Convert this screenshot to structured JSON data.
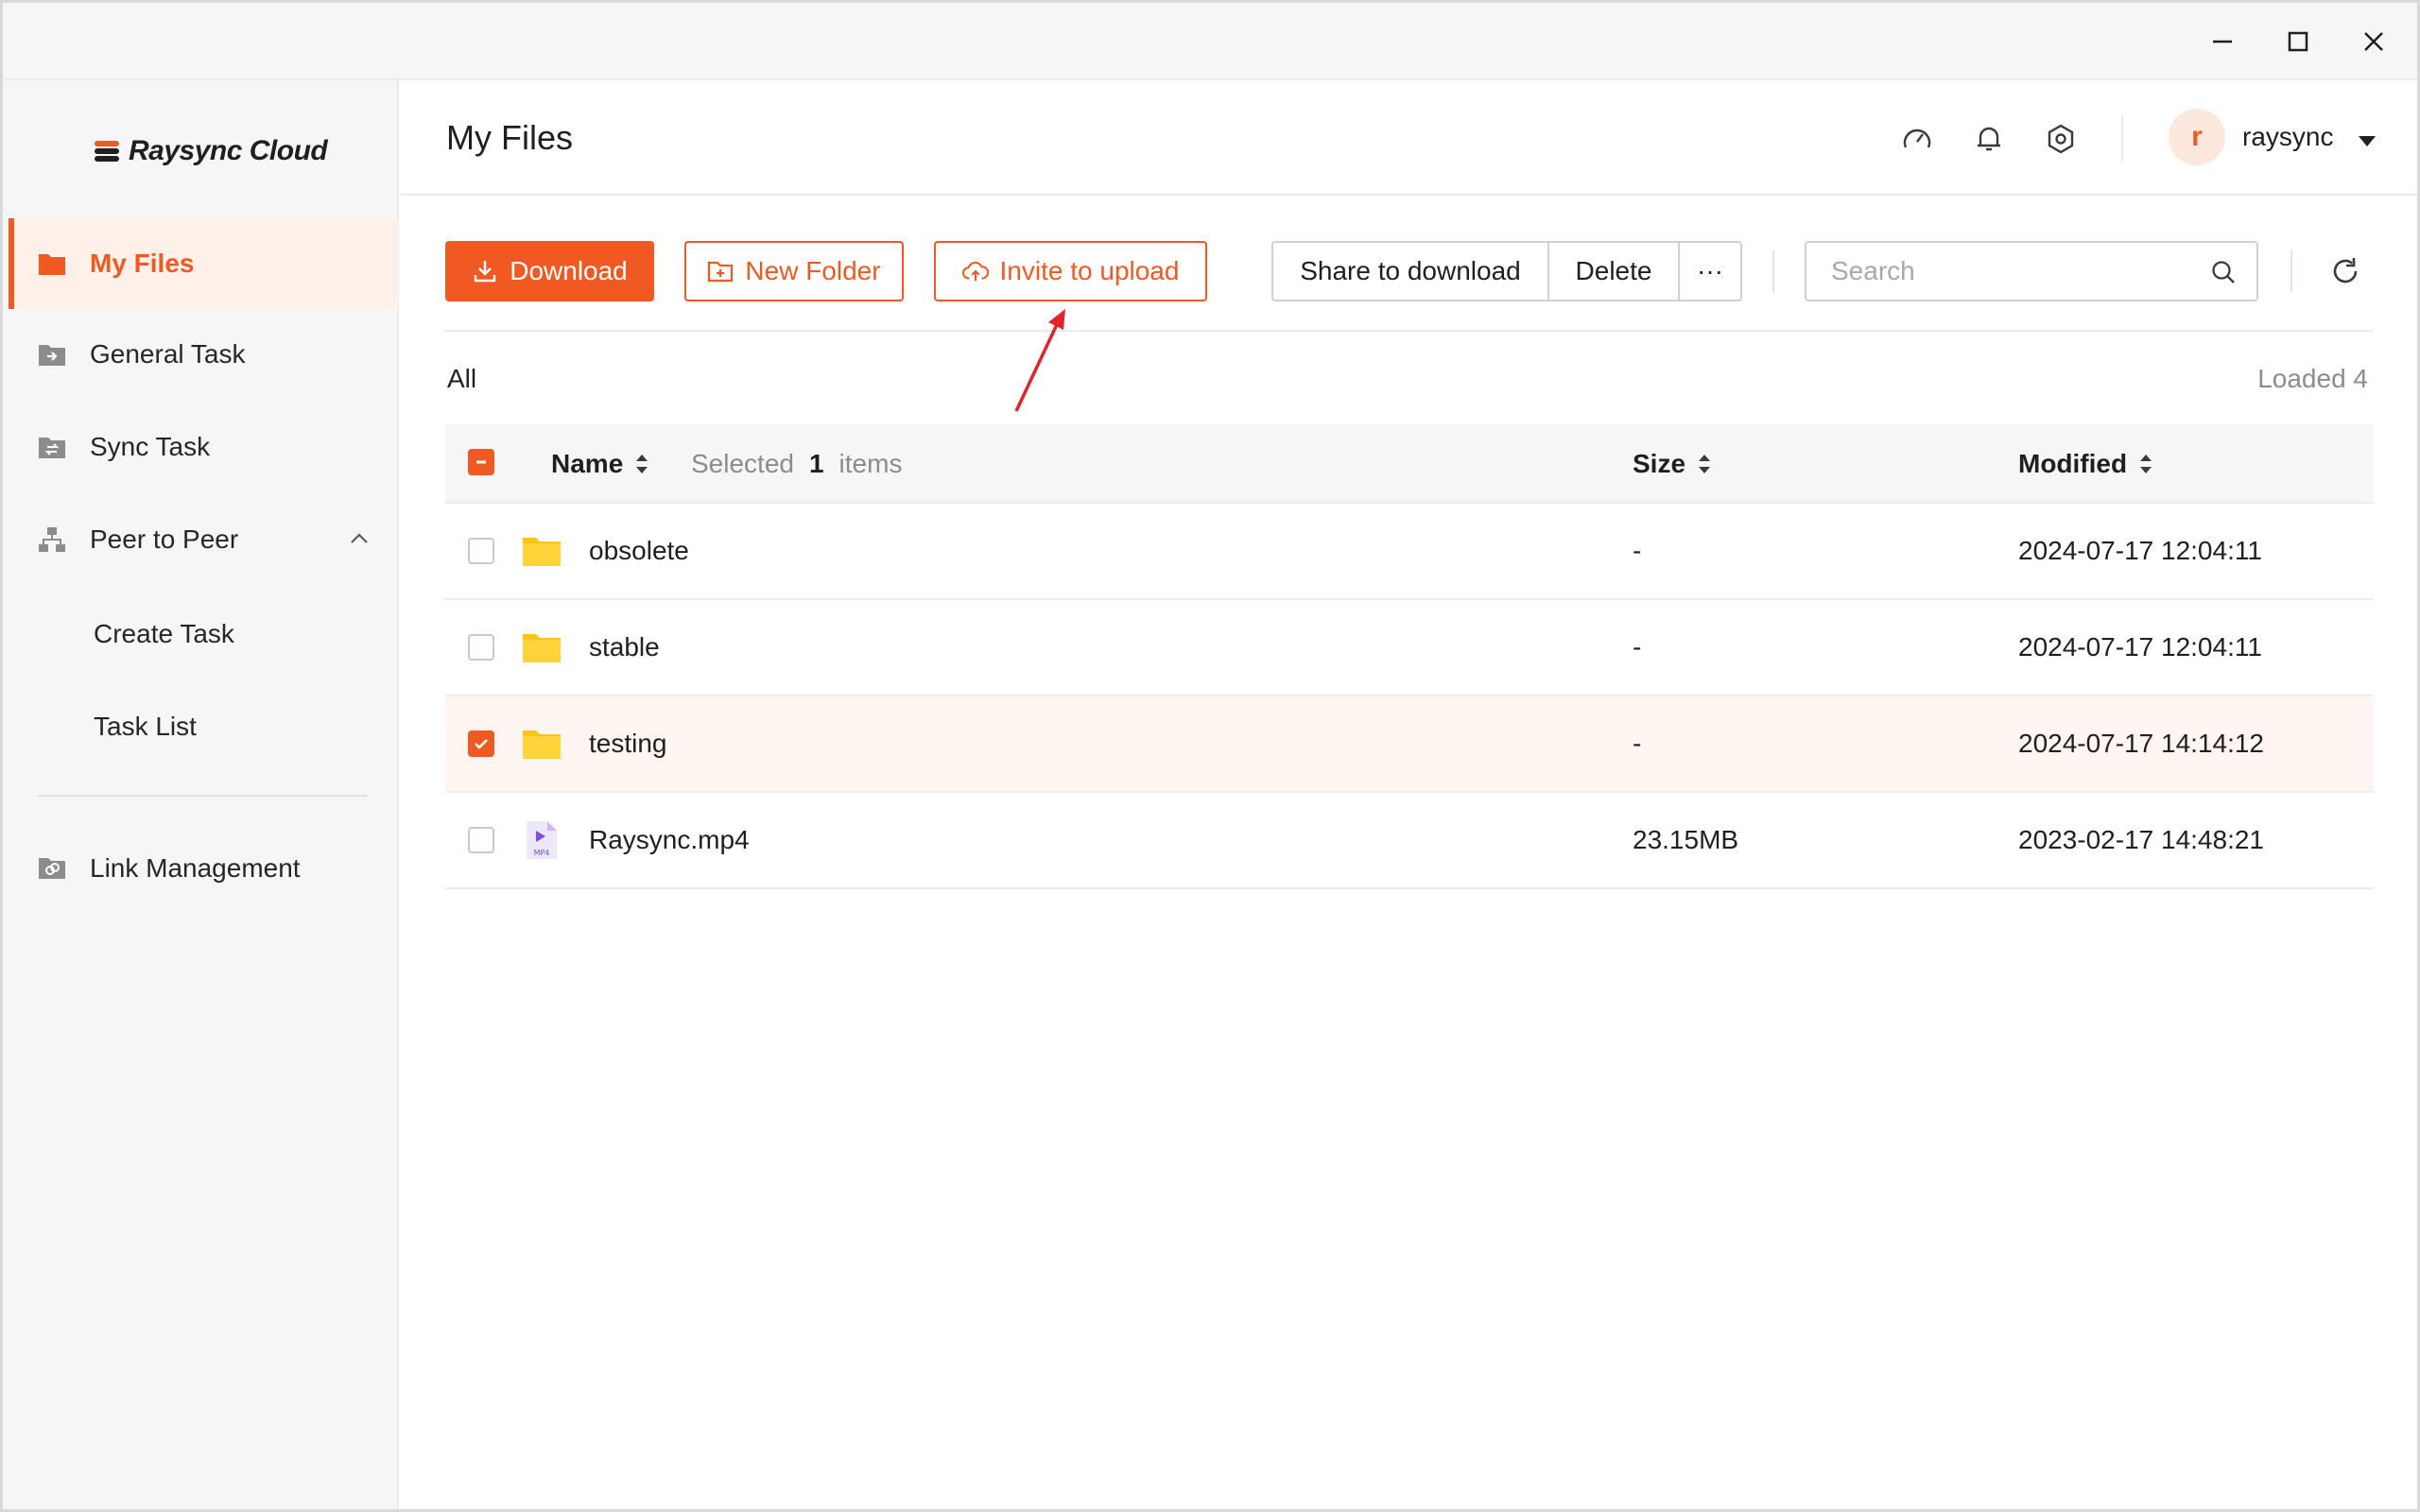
{
  "app": {
    "logo_text": "Raysync Cloud",
    "accent": "#f05a22"
  },
  "sidebar": {
    "items": [
      {
        "label": "My Files",
        "icon": "folder-icon",
        "active": true
      },
      {
        "label": "General Task",
        "icon": "task-folder-icon"
      },
      {
        "label": "Sync Task",
        "icon": "sync-folder-icon"
      },
      {
        "label": "Peer to Peer",
        "icon": "network-icon"
      },
      {
        "label": "Create Task"
      },
      {
        "label": "Task List"
      },
      {
        "label": "Link Management",
        "icon": "link-icon"
      }
    ]
  },
  "header": {
    "title": "My Files",
    "icons": [
      "speed-icon",
      "bell-icon",
      "settings-icon"
    ],
    "avatar_letter": "r",
    "username": "raysync"
  },
  "toolbar": {
    "download": "Download",
    "new_folder": "New Folder",
    "invite_upload": "Invite to upload",
    "share_download": "Share to download",
    "delete": "Delete",
    "more": "···",
    "search_placeholder": "Search"
  },
  "breadcrumb": "All",
  "loaded": "Loaded 4",
  "table": {
    "headers": {
      "name": "Name",
      "size": "Size",
      "modified": "Modified"
    },
    "selected_prefix": "Selected",
    "selected_count": "1",
    "selected_suffix": "items",
    "rows": [
      {
        "name": "obsolete",
        "type": "folder",
        "size": "-",
        "modified": "2024-07-17 12:04:11",
        "checked": false
      },
      {
        "name": "stable",
        "type": "folder",
        "size": "-",
        "modified": "2024-07-17 12:04:11",
        "checked": false
      },
      {
        "name": "testing",
        "type": "folder",
        "size": "-",
        "modified": "2024-07-17 14:14:12",
        "checked": true
      },
      {
        "name": "Raysync.mp4",
        "type": "mp4",
        "size": "23.15MB",
        "modified": "2023-02-17 14:48:21",
        "checked": false
      }
    ]
  }
}
